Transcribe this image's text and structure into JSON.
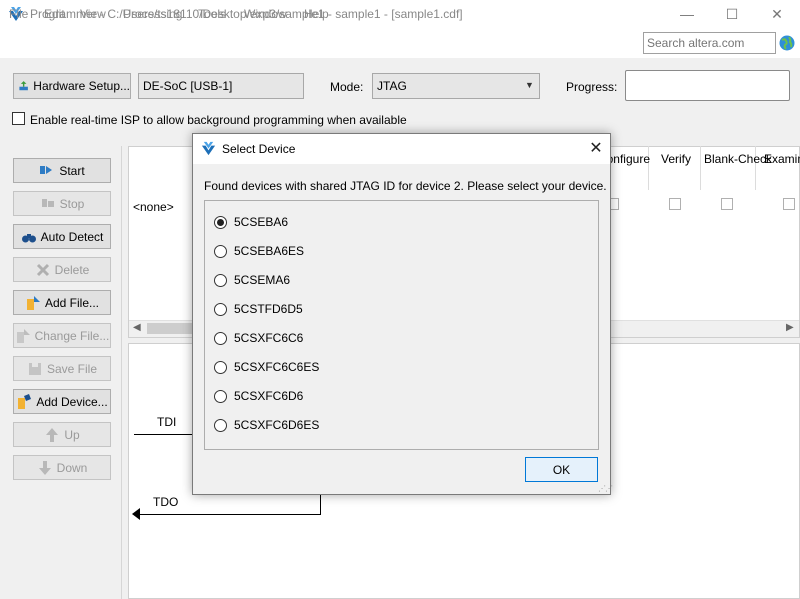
{
  "window": {
    "title": "Programmer - C:/Users/ts18110/Desktop/exp3/sample1 - sample1 - [sample1.cdf]",
    "min_glyph": "—",
    "max_glyph": "☐",
    "close_glyph": "✕"
  },
  "menu": {
    "file": "File",
    "edit": "Edit",
    "view": "View",
    "processing": "Processing",
    "tools": "Tools",
    "window": "Window",
    "help": "Help"
  },
  "search": {
    "placeholder": "Search altera.com"
  },
  "toolbar": {
    "hardware_setup": "Hardware Setup...",
    "hardware_value": "DE-SoC [USB-1]",
    "mode_label": "Mode:",
    "mode_value": "JTAG",
    "progress_label": "Progress:",
    "isp_label": "Enable real-time ISP to allow background programming when available"
  },
  "sidebar": {
    "start": "Start",
    "stop": "Stop",
    "auto_detect": "Auto Detect",
    "delete": "Delete",
    "add_file": "Add File...",
    "change_file": "Change File...",
    "save_file": "Save File",
    "add_device": "Add Device...",
    "up": "Up",
    "down": "Down"
  },
  "device_table": {
    "none_row": "<none>",
    "col_program": "Program/ Configure",
    "col_verify": "Verify",
    "col_blank_check": "Blank-Check",
    "col_examine": "Examine"
  },
  "chain": {
    "tdi": "TDI",
    "tdo": "TDO"
  },
  "dialog": {
    "title": "Select Device",
    "close_glyph": "✕",
    "message": "Found devices with shared JTAG ID for device 2. Please select your device.",
    "options": [
      "5CSEBA6",
      "5CSEBA6ES",
      "5CSEMA6",
      "5CSTFD6D5",
      "5CSXFC6C6",
      "5CSXFC6C6ES",
      "5CSXFC6D6",
      "5CSXFC6D6ES"
    ],
    "selected_index": 0,
    "ok": "OK"
  },
  "colors": {
    "accent_blue": "#0078d7",
    "window_bg": "#f0f0f0",
    "altera_icon_blue": "#1d6fb8"
  }
}
